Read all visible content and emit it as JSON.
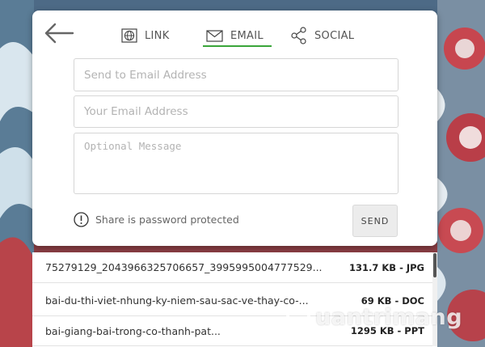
{
  "tabs": [
    {
      "label": "LINK",
      "icon": "globe-icon",
      "active": false
    },
    {
      "label": "EMAIL",
      "icon": "envelope-icon",
      "active": true
    },
    {
      "label": "SOCIAL",
      "icon": "share-icon",
      "active": false
    }
  ],
  "accent_color": "#3aa53a",
  "form": {
    "to_placeholder": "Send to Email Address",
    "from_placeholder": "Your Email Address",
    "message_placeholder": "Optional Message",
    "password_note": "Share is password protected",
    "send_label": "SEND"
  },
  "files": [
    {
      "name": "75279129_2043966325706657_3995995004777529...",
      "meta": "131.7 KB - JPG"
    },
    {
      "name": "bai-du-thi-viet-nhung-ky-niem-sau-sac-ve-thay-co-...",
      "meta": "69 KB - DOC"
    },
    {
      "name": "bai-giang-bai-trong-co-thanh-pat...",
      "meta": "1295 KB - PPT"
    }
  ],
  "watermark": {
    "text": "uantrimang"
  }
}
